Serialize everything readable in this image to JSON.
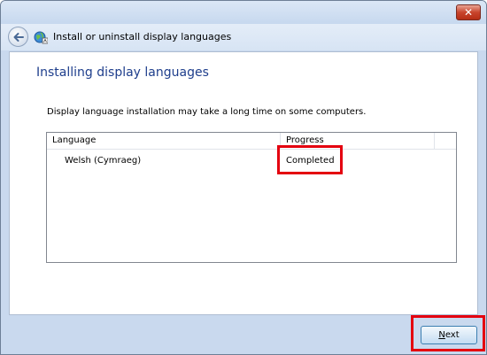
{
  "window": {
    "close_symbol": "✕",
    "nav_title": "Install or uninstall display languages"
  },
  "main": {
    "heading": "Installing display languages",
    "description": "Display language installation may take a long time on some computers."
  },
  "list": {
    "headers": [
      "Language",
      "Progress"
    ],
    "rows": [
      {
        "language": "Welsh (Cymraeg)",
        "progress": "Completed"
      }
    ]
  },
  "footer": {
    "next_label": "Next",
    "next_access_key": "N",
    "next_rest": "ext"
  },
  "icons": [
    "back-arrow-icon",
    "language-globe-icon",
    "close-icon"
  ],
  "colors": {
    "heading": "#1e3e8c",
    "highlight": "#e4000f",
    "frame": "#c9d9ee"
  }
}
